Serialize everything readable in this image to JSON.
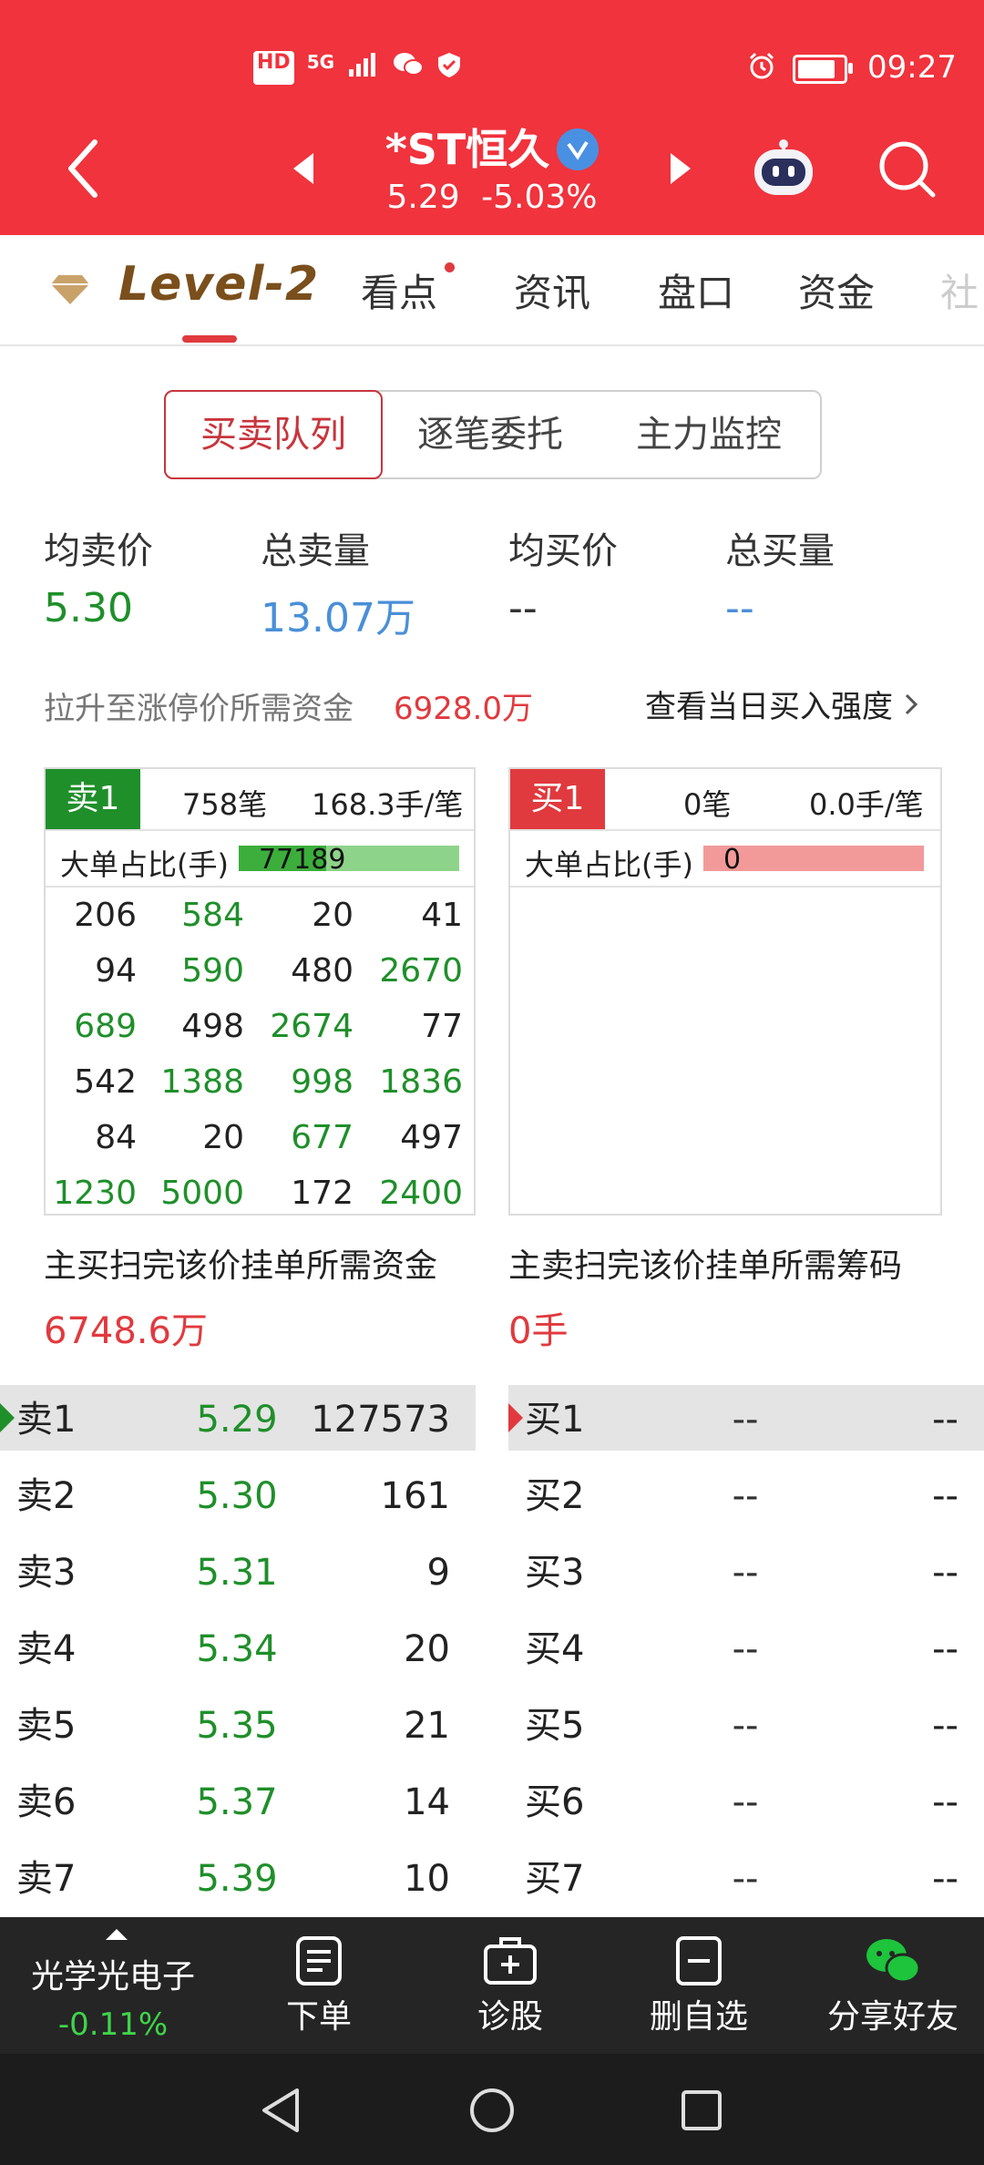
{
  "status_bar": {
    "time": "09:27",
    "left_icons": [
      "HD",
      "5G",
      "signal-icon",
      "wechat-icon",
      "shield-icon"
    ],
    "right_icons": [
      "alarm-icon",
      "battery-icon"
    ]
  },
  "header": {
    "stock_name": "*ST恒久",
    "price": "5.29",
    "change_pct": "-5.03%"
  },
  "tabs": {
    "level2": "Level-2",
    "items": [
      "看点",
      "资讯",
      "盘口",
      "资金",
      "社"
    ]
  },
  "segments": [
    "买卖队列",
    "逐笔委托",
    "主力监控"
  ],
  "stats": {
    "avg_sell_label": "均卖价",
    "avg_sell_value": "5.30",
    "total_sell_label": "总卖量",
    "total_sell_value": "13.07万",
    "avg_buy_label": "均买价",
    "avg_buy_value": "--",
    "total_buy_label": "总买量",
    "total_buy_value": "--"
  },
  "funds_line": {
    "label": "拉升至涨停价所需资金",
    "value": "6928.0万",
    "link": "查看当日买入强度"
  },
  "sell_box": {
    "tag": "卖1",
    "orders": "758笔",
    "per_order": "168.3手/笔",
    "big_label": "大单占比(手)",
    "big_value": "77189",
    "grid": [
      [
        {
          "v": "206",
          "c": "b"
        },
        {
          "v": "584",
          "c": "g"
        },
        {
          "v": "20",
          "c": "b"
        },
        {
          "v": "41",
          "c": "b"
        }
      ],
      [
        {
          "v": "94",
          "c": "b"
        },
        {
          "v": "590",
          "c": "g"
        },
        {
          "v": "480",
          "c": "b"
        },
        {
          "v": "2670",
          "c": "g"
        }
      ],
      [
        {
          "v": "689",
          "c": "g"
        },
        {
          "v": "498",
          "c": "b"
        },
        {
          "v": "2674",
          "c": "g"
        },
        {
          "v": "77",
          "c": "b"
        }
      ],
      [
        {
          "v": "542",
          "c": "b"
        },
        {
          "v": "1388",
          "c": "g"
        },
        {
          "v": "998",
          "c": "g"
        },
        {
          "v": "1836",
          "c": "g"
        }
      ],
      [
        {
          "v": "84",
          "c": "b"
        },
        {
          "v": "20",
          "c": "b"
        },
        {
          "v": "677",
          "c": "g"
        },
        {
          "v": "497",
          "c": "b"
        }
      ],
      [
        {
          "v": "1230",
          "c": "g"
        },
        {
          "v": "5000",
          "c": "g"
        },
        {
          "v": "172",
          "c": "b"
        },
        {
          "v": "2400",
          "c": "g"
        }
      ]
    ],
    "footer_label": "主买扫完该价挂单所需资金",
    "footer_value": "6748.6万"
  },
  "buy_box": {
    "tag": "买1",
    "orders": "0笔",
    "per_order": "0.0手/笔",
    "big_label": "大单占比(手)",
    "big_value": "0",
    "footer_label": "主卖扫完该价挂单所需筹码",
    "footer_value": "0手"
  },
  "sell_rows": [
    {
      "label": "卖1",
      "price": "5.29",
      "vol": "127573"
    },
    {
      "label": "卖2",
      "price": "5.30",
      "vol": "161"
    },
    {
      "label": "卖3",
      "price": "5.31",
      "vol": "9"
    },
    {
      "label": "卖4",
      "price": "5.34",
      "vol": "20"
    },
    {
      "label": "卖5",
      "price": "5.35",
      "vol": "21"
    },
    {
      "label": "卖6",
      "price": "5.37",
      "vol": "14"
    },
    {
      "label": "卖7",
      "price": "5.39",
      "vol": "10"
    }
  ],
  "buy_rows": [
    {
      "label": "买1",
      "price": "--",
      "vol": "--"
    },
    {
      "label": "买2",
      "price": "--",
      "vol": "--"
    },
    {
      "label": "买3",
      "price": "--",
      "vol": "--"
    },
    {
      "label": "买4",
      "price": "--",
      "vol": "--"
    },
    {
      "label": "买5",
      "price": "--",
      "vol": "--"
    },
    {
      "label": "买6",
      "price": "--",
      "vol": "--"
    },
    {
      "label": "买7",
      "price": "--",
      "vol": "--"
    }
  ],
  "bottom_bar": {
    "sector_name": "光学光电子",
    "sector_change": "-0.11%",
    "items": [
      "下单",
      "诊股",
      "删自选",
      "分享好友"
    ]
  },
  "colors": {
    "header_red": "#f0333d",
    "green": "#1f8f2a",
    "red": "#e03a3e",
    "blue": "#4a8fd8"
  }
}
